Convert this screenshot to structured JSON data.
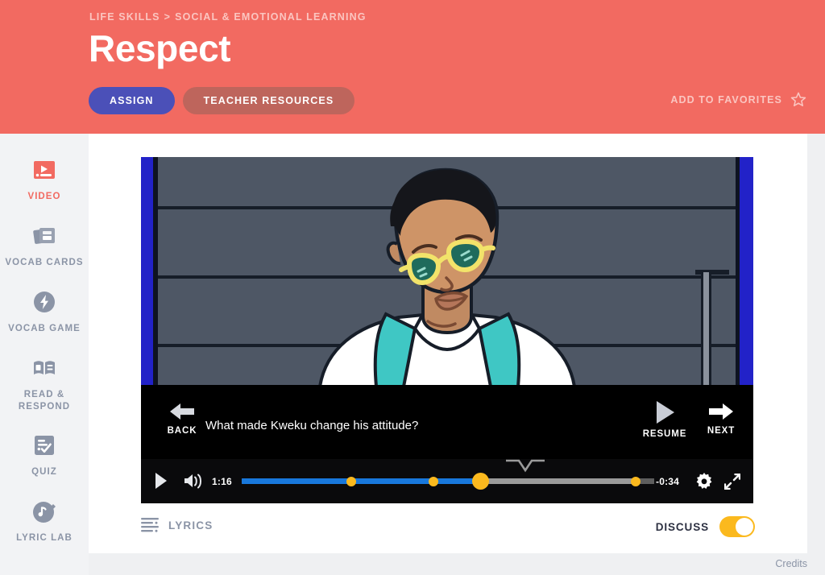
{
  "header": {
    "breadcrumb": {
      "parent": "LIFE SKILLS",
      "separator": ">",
      "current": "SOCIAL & EMOTIONAL LEARNING"
    },
    "title": "Respect",
    "assign_label": "ASSIGN",
    "teacher_resources_label": "TEACHER RESOURCES",
    "favorites_label": "ADD TO FAVORITES",
    "favorites_icon": "star-outline-icon",
    "background_color": "#F26A61",
    "assign_color": "#4B50B8",
    "teacher_resources_color": "#BE655C"
  },
  "sidebar": {
    "items": [
      {
        "label": "VIDEO",
        "icon": "video-icon",
        "active": true
      },
      {
        "label": "VOCAB CARDS",
        "icon": "cards-icon",
        "active": false
      },
      {
        "label": "VOCAB GAME",
        "icon": "lightning-bolt-icon",
        "active": false
      },
      {
        "label": "READ &\nRESPOND",
        "icon": "open-book-icon",
        "active": false
      },
      {
        "label": "QUIZ",
        "icon": "checklist-icon",
        "active": false
      },
      {
        "label": "LYRIC LAB",
        "icon": "music-note-icon",
        "active": false
      }
    ],
    "active_color": "#F26A61",
    "inactive_color": "#8B94A6"
  },
  "player": {
    "question": "What made Kweku change his attitude?",
    "back_label": "BACK",
    "resume_label": "RESUME",
    "next_label": "NEXT",
    "back_icon": "arrow-left-icon",
    "resume_icon": "play-triangle-icon",
    "next_icon": "arrow-right-icon",
    "elapsed_time": "1:16",
    "remaining_time": "-0:34",
    "play_icon": "play-icon",
    "volume_icon": "volume-on-icon",
    "settings_icon": "gear-icon",
    "fullscreen_icon": "expand-icon",
    "progress_percent": 58,
    "buffered_percent": 96,
    "marker_percents": [
      26.6,
      46.5,
      95.5
    ],
    "played_color": "#1878DC",
    "marker_color": "#FBB91E",
    "track_color": "#9A9A9A"
  },
  "under_video": {
    "lyrics_label": "LYRICS",
    "lyrics_icon": "lyrics-lines-icon",
    "discuss_label": "DISCUSS",
    "discuss_on": true,
    "toggle_color": "#FBB91E"
  },
  "footer": {
    "credits_label": "Credits"
  }
}
